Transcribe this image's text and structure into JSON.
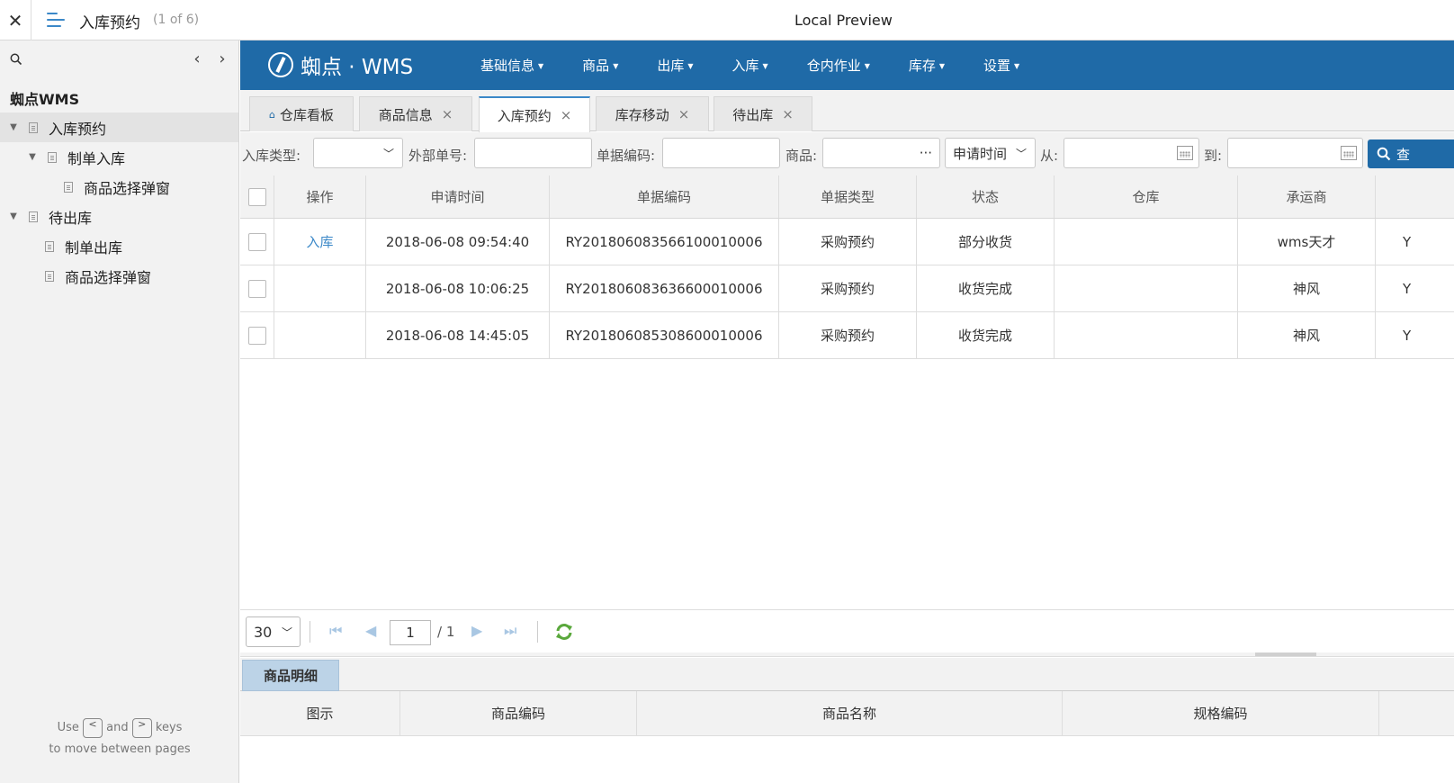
{
  "topbar": {
    "doc_title": "入库预约",
    "doc_count": "(1 of 6)",
    "preview_label": "Local Preview"
  },
  "sidebar": {
    "root": "蜘点WMS",
    "items": [
      {
        "label": "入库预约"
      },
      {
        "label": "制单入库"
      },
      {
        "label": "商品选择弹窗"
      },
      {
        "label": "待出库"
      },
      {
        "label": "制单出库"
      },
      {
        "label": "商品选择弹窗"
      }
    ],
    "hint_use": "Use",
    "hint_key_prev": "<",
    "hint_and": "and",
    "hint_key_next": ">",
    "hint_keys": "keys",
    "hint_line2": "to move between pages"
  },
  "app": {
    "logo_text": "蜘点 · WMS",
    "nav": [
      "基础信息",
      "商品",
      "出库",
      "入库",
      "仓内作业",
      "库存",
      "设置"
    ],
    "tabs": [
      {
        "label": "仓库看板",
        "closable": false
      },
      {
        "label": "商品信息",
        "closable": true
      },
      {
        "label": "入库预约",
        "closable": true,
        "active": true
      },
      {
        "label": "库存移动",
        "closable": true
      },
      {
        "label": "待出库",
        "closable": true
      }
    ],
    "tab_close": "×"
  },
  "filters": {
    "type_label": "入库类型:",
    "ext_label": "外部单号:",
    "code_label": "单据编码:",
    "goods_label": "商品:",
    "goods_more": "···",
    "date_field": "申请时间",
    "from_label": "从:",
    "to_label": "到:",
    "search_button": "查"
  },
  "grid": {
    "columns": [
      "操作",
      "申请时间",
      "单据编码",
      "单据类型",
      "状态",
      "仓库",
      "承运商"
    ],
    "rows": [
      {
        "action": "入库",
        "time": "2018-06-08 09:54:40",
        "code": "RY201806083566100010006",
        "type": "采购预约",
        "status": "部分收货",
        "warehouse": "",
        "carrier": "wms天才",
        "extra": "Y"
      },
      {
        "action": "",
        "time": "2018-06-08 10:06:25",
        "code": "RY201806083636600010006",
        "type": "采购预约",
        "status": "收货完成",
        "warehouse": "",
        "carrier": "神风",
        "extra": "Y"
      },
      {
        "action": "",
        "time": "2018-06-08 14:45:05",
        "code": "RY201806085308600010006",
        "type": "采购预约",
        "status": "收货完成",
        "warehouse": "",
        "carrier": "神风",
        "extra": "Y"
      }
    ]
  },
  "pager": {
    "page_size": "30",
    "current_page": "1",
    "total": "/ 1"
  },
  "detail": {
    "tab": "商品明细",
    "columns": [
      "图示",
      "商品编码",
      "商品名称",
      "规格编码"
    ]
  },
  "colors": {
    "header_bg": "#1f6aa7",
    "accent": "#3b88c8",
    "detail_tab_bg": "#bcd3e7",
    "refresh_green": "#5aa83c"
  }
}
